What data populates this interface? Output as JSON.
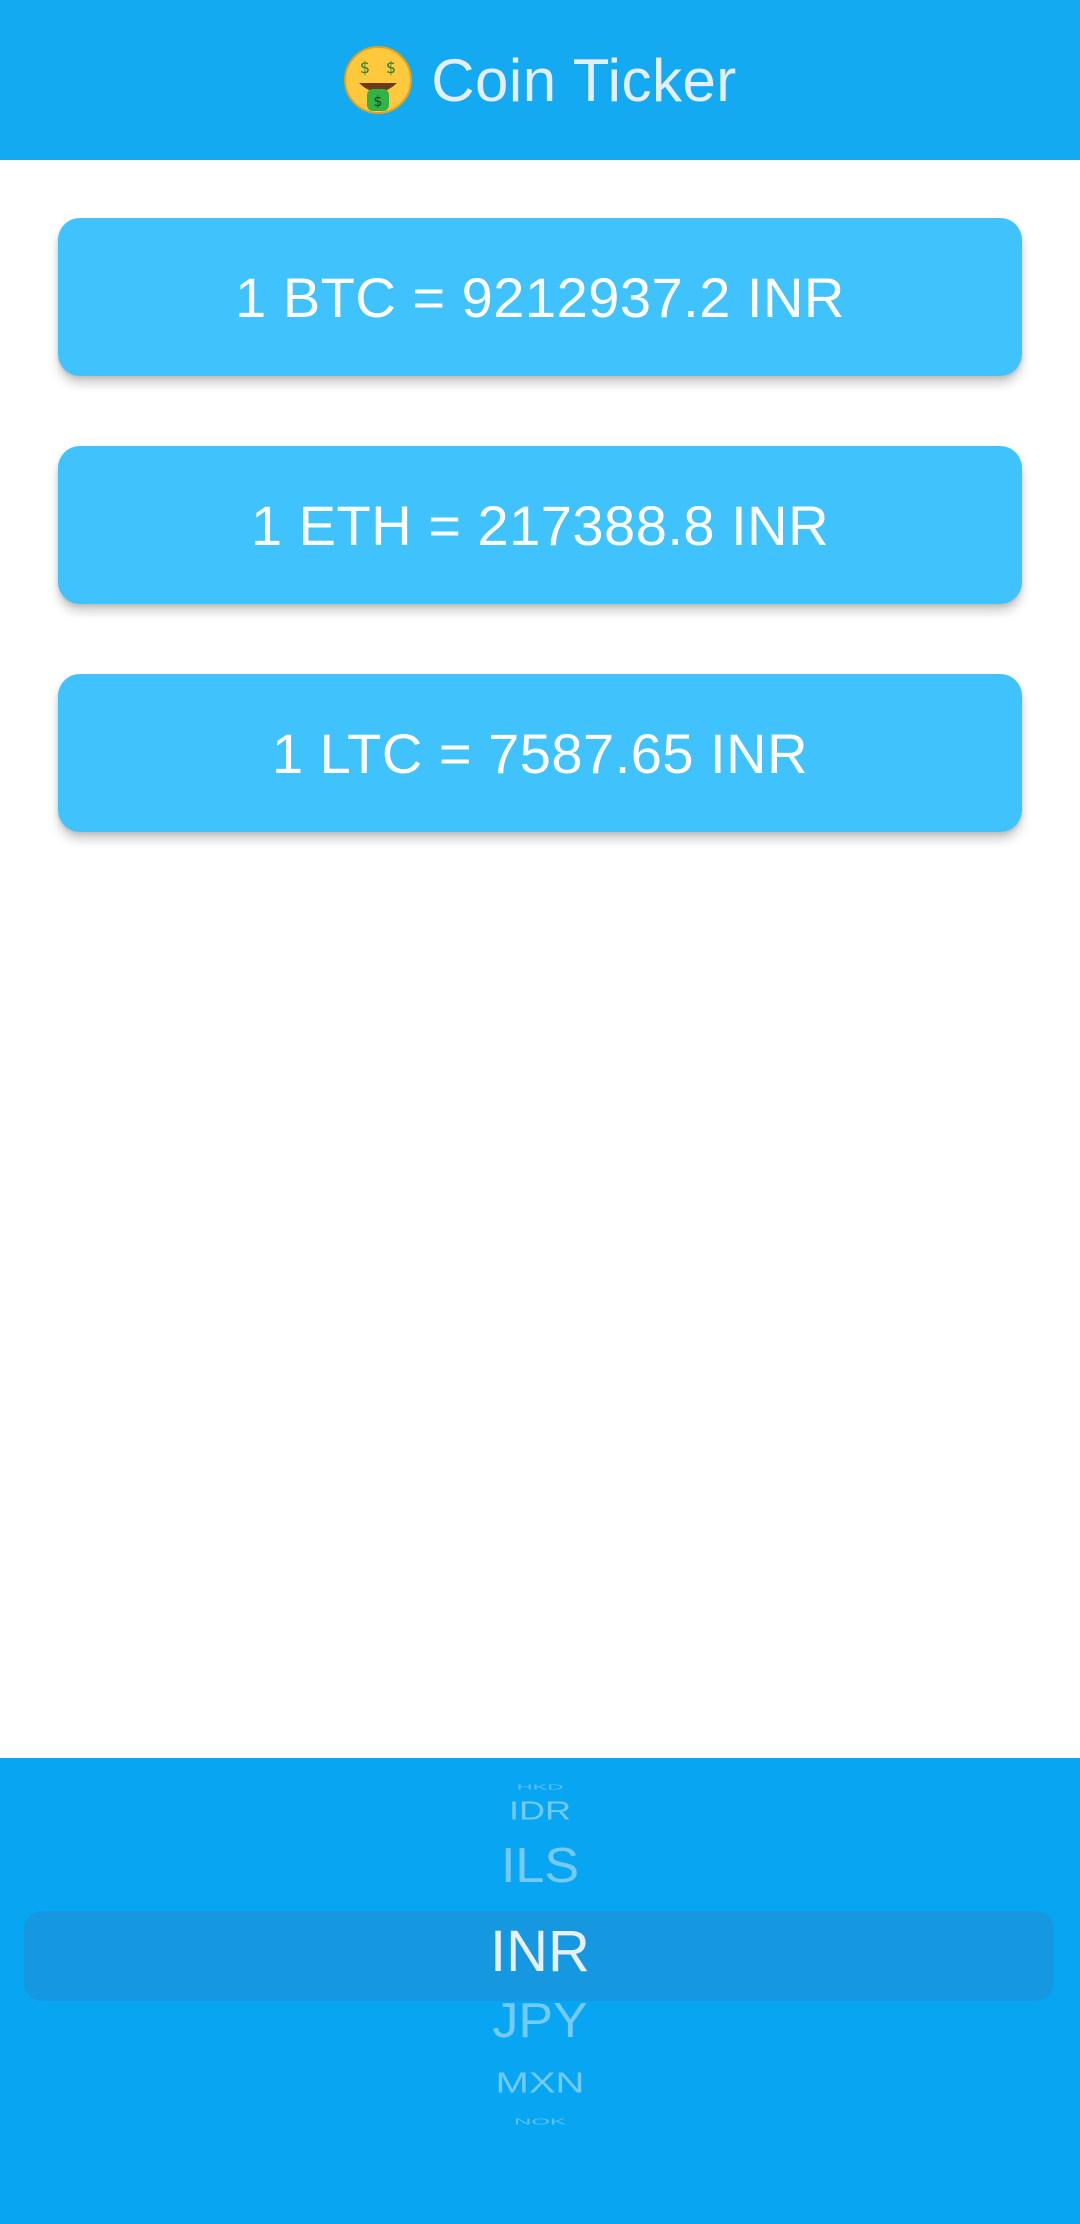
{
  "appbar": {
    "icon": "money-mouth-face-icon",
    "title": "Coin Ticker"
  },
  "cards": [
    {
      "text": "1 BTC = 9212937.2 INR"
    },
    {
      "text": "1 ETH = 217388.8 INR"
    },
    {
      "text": "1 LTC = 7587.65 INR"
    }
  ],
  "picker": {
    "selected": "INR",
    "items": [
      "HKD",
      "IDR",
      "ILS",
      "INR",
      "JPY",
      "MXN",
      "NOK"
    ]
  },
  "colors": {
    "appbar": "#14aaf2",
    "card": "#40c3fd",
    "picker": "#08a6f2"
  }
}
